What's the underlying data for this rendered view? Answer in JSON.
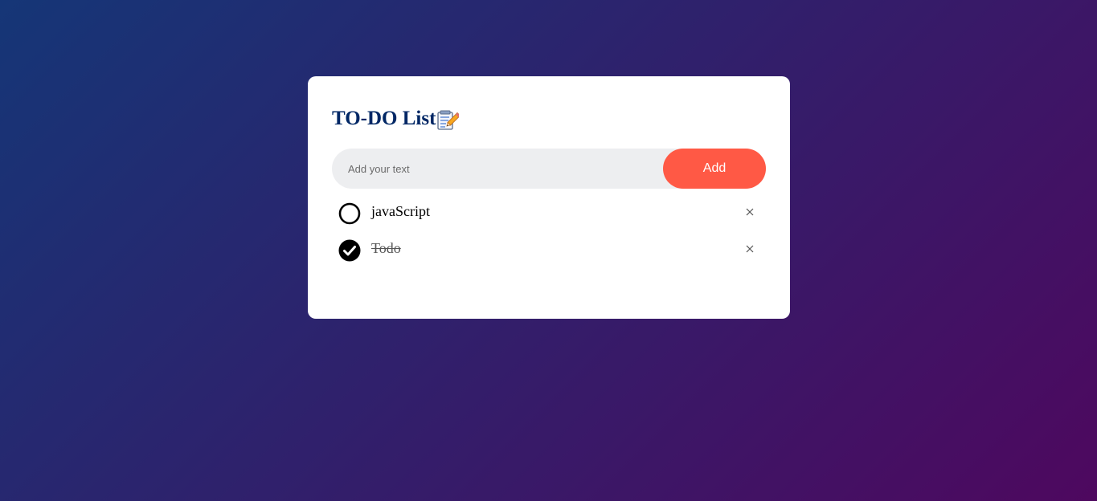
{
  "app": {
    "title": "TO-DO List",
    "title_icon": "memo-pencil-icon"
  },
  "input": {
    "placeholder": "Add your text",
    "value": ""
  },
  "add_button": {
    "label": "Add"
  },
  "colors": {
    "background_start": "#153677",
    "background_end": "#4e085f",
    "title": "#002765",
    "accent": "#ff5945",
    "input_bg": "#edeef0"
  },
  "tasks": [
    {
      "text": "javaScript",
      "checked": false
    },
    {
      "text": "Todo",
      "checked": true
    }
  ]
}
